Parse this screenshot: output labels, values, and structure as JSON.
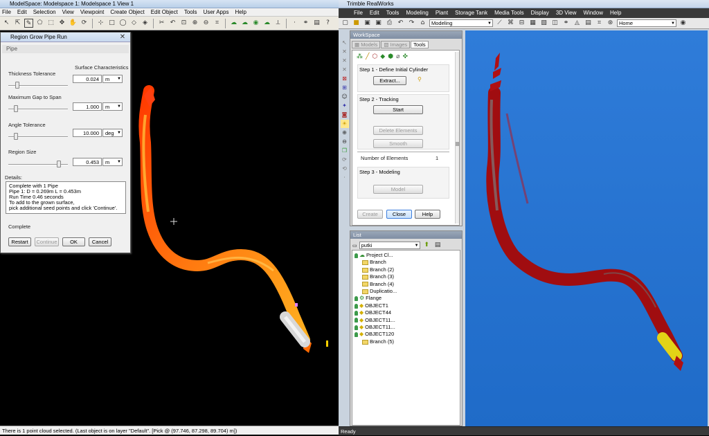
{
  "left_app": {
    "title": "ModelSpace: Modelspace 1: Modelspace 1 View 1",
    "menu": [
      "File",
      "Edit",
      "Selection",
      "View",
      "Viewpoint",
      "Create Object",
      "Edit Object",
      "Tools",
      "User Apps",
      "Help"
    ],
    "toolbar_icons": [
      "cursor-icon",
      "select-icon",
      "lasso-icon",
      "polygon-icon",
      "rect-select-icon",
      "move-icon",
      "pan-icon",
      "rotate-icon",
      "crosshair-icon",
      "cut-icon",
      "copy-icon",
      "paste-icon",
      "undo-icon",
      "redo-icon",
      "zoom-icon",
      "zoom-window-icon",
      "zoom-fit-icon",
      "fence-icon",
      "cloud-icon",
      "cloud2-icon",
      "mesh-icon",
      "measure-icon",
      "point-icon",
      "link-icon",
      "layer-icon",
      "help-icon"
    ],
    "status": "There is 1 point cloud selected. (Last object is on layer \"Default\". [Pick @ (97.746, 87.298, 89.704) m])",
    "dialog": {
      "title": "Region Grow Pipe Run",
      "group": "Pipe",
      "surface_characteristics": "Surface Characteristics",
      "fields": [
        {
          "label": "Thickness Tolerance",
          "value": "0.024",
          "unit": "m",
          "slider": 0.12
        },
        {
          "label": "Maximum Gap to Span",
          "value": "1.000",
          "unit": "m",
          "slider": 0.1
        },
        {
          "label": "Angle Tolerance",
          "value": "10.000",
          "unit": "deg",
          "slider": 0.1
        },
        {
          "label": "Region Size",
          "value": "0.453",
          "unit": "m",
          "slider": 0.88
        }
      ],
      "details_label": "Details:",
      "details_lines": [
        "Complete with 1 Pipe",
        "Pipe   1: D = 0.269m  L = 0.453m",
        "Run Time     0.46 seconds",
        "To add to the grown surface,",
        "pick additional seed points and click 'Continue'."
      ],
      "complete": "Complete",
      "buttons": {
        "restart": "Restart",
        "continue": "Continue",
        "ok": "OK",
        "cancel": "Cancel"
      }
    }
  },
  "right_app": {
    "title": "Trimble RealWorks",
    "menu": [
      "File",
      "Edit",
      "Tools",
      "Modeling",
      "Plant",
      "Storage Tank",
      "Media Tools",
      "Display",
      "3D View",
      "Window",
      "Help"
    ],
    "mode_combo": "Modeling",
    "view_combo": "Home",
    "workspace": {
      "title": "WorkSpace",
      "tabs": [
        "Models",
        "Images",
        "Tools"
      ],
      "step1": {
        "title": "Step 1 - Define Initial Cylinder",
        "button": "Extract..."
      },
      "step2": {
        "title": "Step 2 - Tracking",
        "start": "Start",
        "delete": "Delete Elements",
        "smooth": "Smooth"
      },
      "num_elements_label": "Number of Elements",
      "num_elements_value": "1",
      "step3": {
        "title": "Step 3 - Modeling",
        "button": "Model"
      },
      "buttons": {
        "create": "Create",
        "close": "Close",
        "help": "Help"
      }
    },
    "list": {
      "title": "List",
      "combo": "putki",
      "items": [
        {
          "label": "Project Cl...",
          "icon": "project-icon",
          "bulb": true
        },
        {
          "label": "Branch",
          "icon": "folder-icon"
        },
        {
          "label": "Branch (2)",
          "icon": "folder-icon"
        },
        {
          "label": "Branch (3)",
          "icon": "folder-icon"
        },
        {
          "label": "Branch (4)",
          "icon": "folder-icon"
        },
        {
          "label": "Duplicatio...",
          "icon": "folder-icon"
        },
        {
          "label": "Flange",
          "icon": "flange-icon",
          "bulb": true
        },
        {
          "label": "OBJECT1",
          "icon": "object-icon",
          "bulb": true
        },
        {
          "label": "OBJECT44",
          "icon": "object-icon",
          "bulb": true
        },
        {
          "label": "OBJECT11...",
          "icon": "object-icon",
          "bulb": true
        },
        {
          "label": "OBJECT11...",
          "icon": "object-icon",
          "bulb": true
        },
        {
          "label": "OBJECT120",
          "icon": "object-icon",
          "bulb": true
        },
        {
          "label": "Branch (5)",
          "icon": "folder-icon"
        }
      ]
    },
    "status": "Ready"
  }
}
